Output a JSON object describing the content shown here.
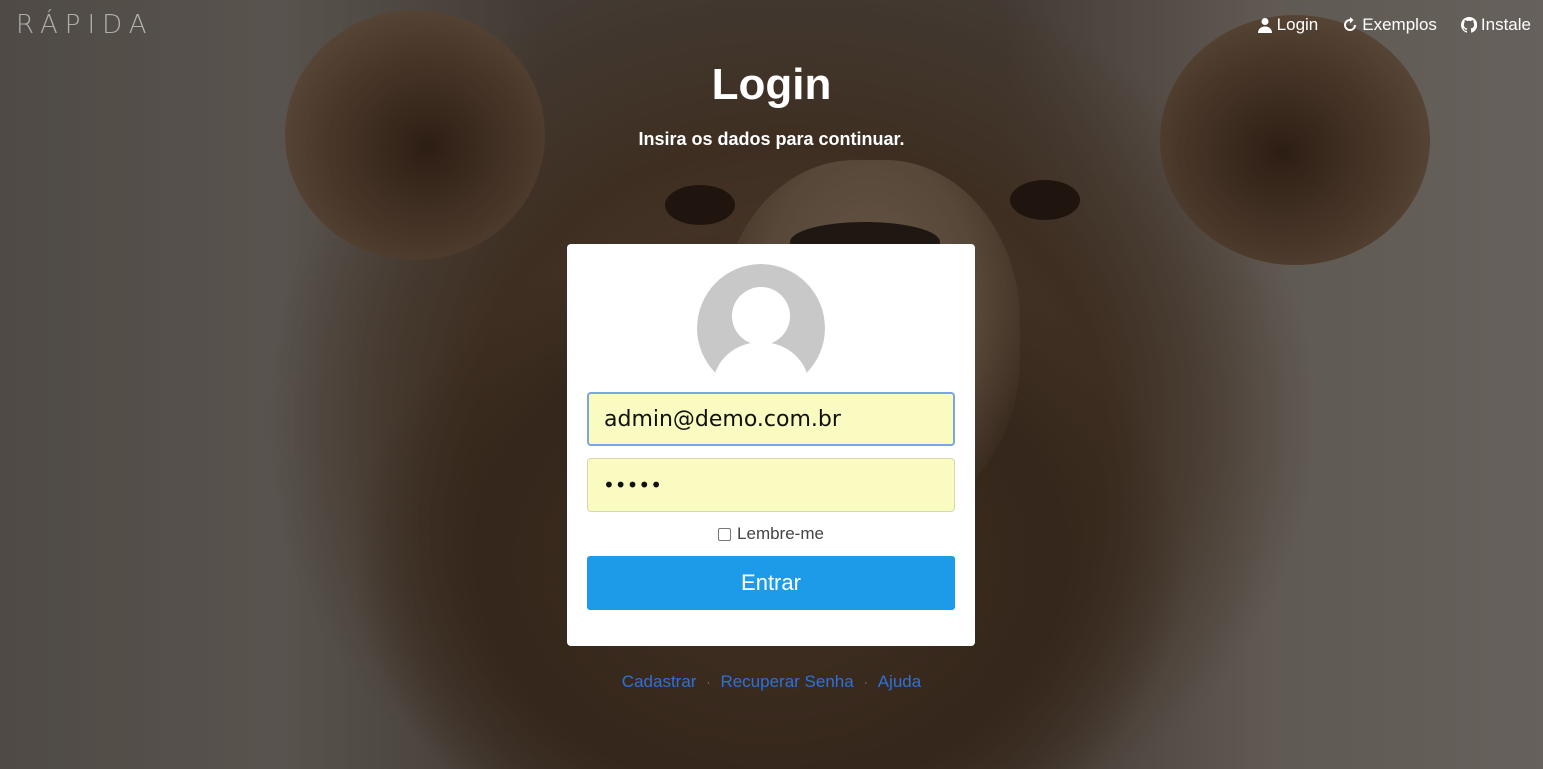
{
  "brand": {
    "logo_text": "RÁPIDA"
  },
  "nav": {
    "items": [
      {
        "label": "Login",
        "icon": "user-icon"
      },
      {
        "label": "Exemplos",
        "icon": "refresh-icon"
      },
      {
        "label": "Instale",
        "icon": "github-icon"
      }
    ]
  },
  "page": {
    "title": "Login",
    "subtitle": "Insira os dados para continuar."
  },
  "form": {
    "email_value": "admin@demo.com.br",
    "password_mask": "•••••",
    "remember_label": "Lembre-me",
    "remember_checked": false,
    "submit_label": "Entrar",
    "avatar_icon": "default-avatar-icon"
  },
  "footer": {
    "links": [
      "Cadastrar",
      "Recuperar Senha",
      "Ajuda"
    ],
    "separator": "·"
  },
  "colors": {
    "primary_button": "#1e9be8",
    "link": "#2c72d8",
    "autofill_bg": "#fafbc0"
  }
}
